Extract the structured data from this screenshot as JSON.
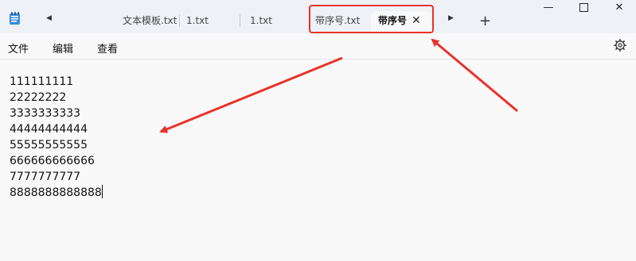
{
  "tabs": [
    {
      "label": "文本模板.txt"
    },
    {
      "label": "1.txt"
    },
    {
      "label": "1.txt"
    },
    {
      "label": "带序号.txt"
    },
    {
      "label": "带序号"
    }
  ],
  "menu": {
    "file": "文件",
    "edit": "编辑",
    "view": "查看"
  },
  "editor": {
    "lines": [
      "111111111",
      "22222222",
      "3333333333",
      "44444444444",
      "55555555555",
      "666666666666",
      "7777777777",
      "8888888888888"
    ]
  },
  "colors": {
    "accent": "#e8332a",
    "titlebar": "#eef1f6",
    "background": "#f9f9f9"
  },
  "icons": [
    "notepad-icon",
    "scroll-left-icon",
    "scroll-right-icon",
    "close-icon",
    "plus-icon",
    "minimize-icon",
    "maximize-icon",
    "gear-icon"
  ]
}
